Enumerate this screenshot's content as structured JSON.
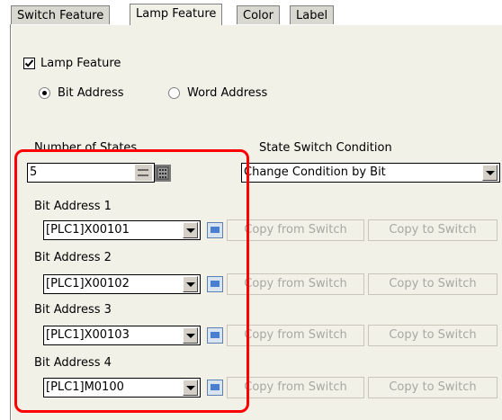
{
  "tabs": [
    {
      "label": "Switch Feature"
    },
    {
      "label": "Lamp Feature"
    },
    {
      "label": "Color"
    },
    {
      "label": "Label"
    }
  ],
  "lamp_feature": {
    "label": "Lamp Feature",
    "checked": true
  },
  "address_type": {
    "bit_label": "Bit Address",
    "word_label": "Word Address",
    "selected": "Bit Address"
  },
  "num_states": {
    "label": "Number of States",
    "value": "5"
  },
  "state_switch": {
    "label": "State Switch Condition",
    "value": "Change Condition by Bit"
  },
  "bit_addresses": [
    {
      "label": "Bit Address 1",
      "value": "[PLC1]X00101"
    },
    {
      "label": "Bit Address 2",
      "value": "[PLC1]X00102"
    },
    {
      "label": "Bit Address 3",
      "value": "[PLC1]X00103"
    },
    {
      "label": "Bit Address 4",
      "value": "[PLC1]M0100"
    }
  ],
  "buttons": {
    "copy_from_switch": "Copy from Switch",
    "copy_to_switch": "Copy to Switch"
  },
  "highlight_color": "#ff0000"
}
